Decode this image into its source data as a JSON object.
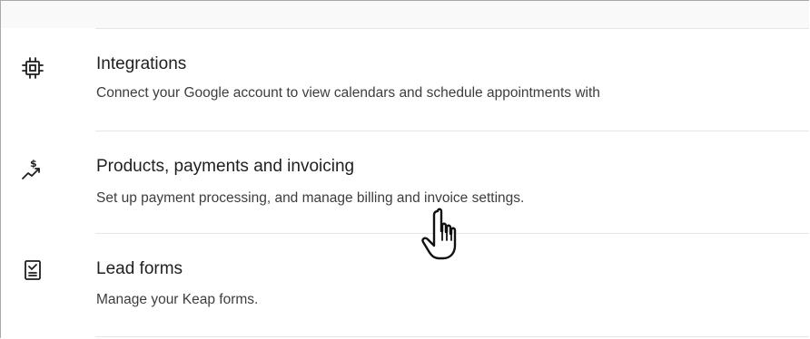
{
  "settings": {
    "items": [
      {
        "title": "Integrations",
        "description": "Connect your Google account to view calendars and schedule appointments with",
        "icon": "chip-icon"
      },
      {
        "title": "Products, payments and invoicing",
        "description": "Set up payment processing, and manage billing and invoice settings.",
        "icon": "dollar-trend-icon"
      },
      {
        "title": "Lead forms",
        "description": "Manage your Keap forms.",
        "icon": "checklist-form-icon"
      }
    ]
  },
  "colors": {
    "text": "#1f1f1f",
    "muted": "#3d3d3d",
    "divider": "#e6e6e6"
  }
}
